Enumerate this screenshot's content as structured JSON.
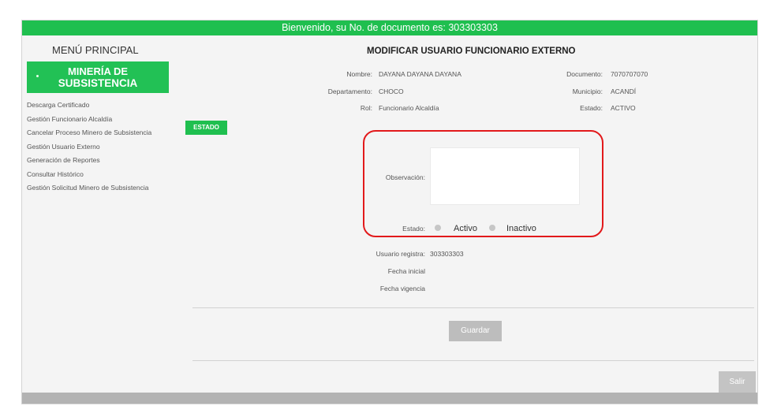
{
  "header": {
    "welcome": "Bienvenido, su No. de documento es: 303303303"
  },
  "sidebar": {
    "title": "MENÚ PRINCIPAL",
    "brand_line1": "MINERÍA DE",
    "brand_line2": "SUBSISTENCIA",
    "items": [
      {
        "label": "Descarga Certificado"
      },
      {
        "label": "Gestión Funcionario Alcaldía"
      },
      {
        "label": "Cancelar Proceso Minero de Subsistencia"
      },
      {
        "label": "Gestión Usuario Externo"
      },
      {
        "label": "Generación de Reportes"
      },
      {
        "label": "Consultar Histórico"
      },
      {
        "label": "Gestión Solicitud Minero de Subsistencia"
      }
    ]
  },
  "estado_button": "ESTADO",
  "main": {
    "title": "MODIFICAR USUARIO FUNCIONARIO EXTERNO",
    "nombre_label": "Nombre:",
    "nombre_value": "DAYANA DAYANA DAYANA",
    "documento_label": "Documento:",
    "documento_value": "7070707070",
    "departamento_label": "Departamento:",
    "departamento_value": "CHOCO",
    "municipio_label": "Municipio:",
    "municipio_value": "ACANDÍ",
    "rol_label": "Rol:",
    "rol_value": "Funcionario Alcaldía",
    "estado_label": "Estado:",
    "estado_value": "ACTIVO",
    "observacion_label": "Observación:",
    "observacion_value": "",
    "estado_radio_label": "Estado:",
    "radio_activo": "Activo",
    "radio_inactivo": "Inactivo",
    "usuario_registra_label": "Usuario registra:",
    "usuario_registra_value": "303303303",
    "fecha_inicial_label": "Fecha inicial",
    "fecha_vigencia_label": "Fecha vigencia"
  },
  "buttons": {
    "guardar": "Guardar",
    "salir": "Salir"
  }
}
